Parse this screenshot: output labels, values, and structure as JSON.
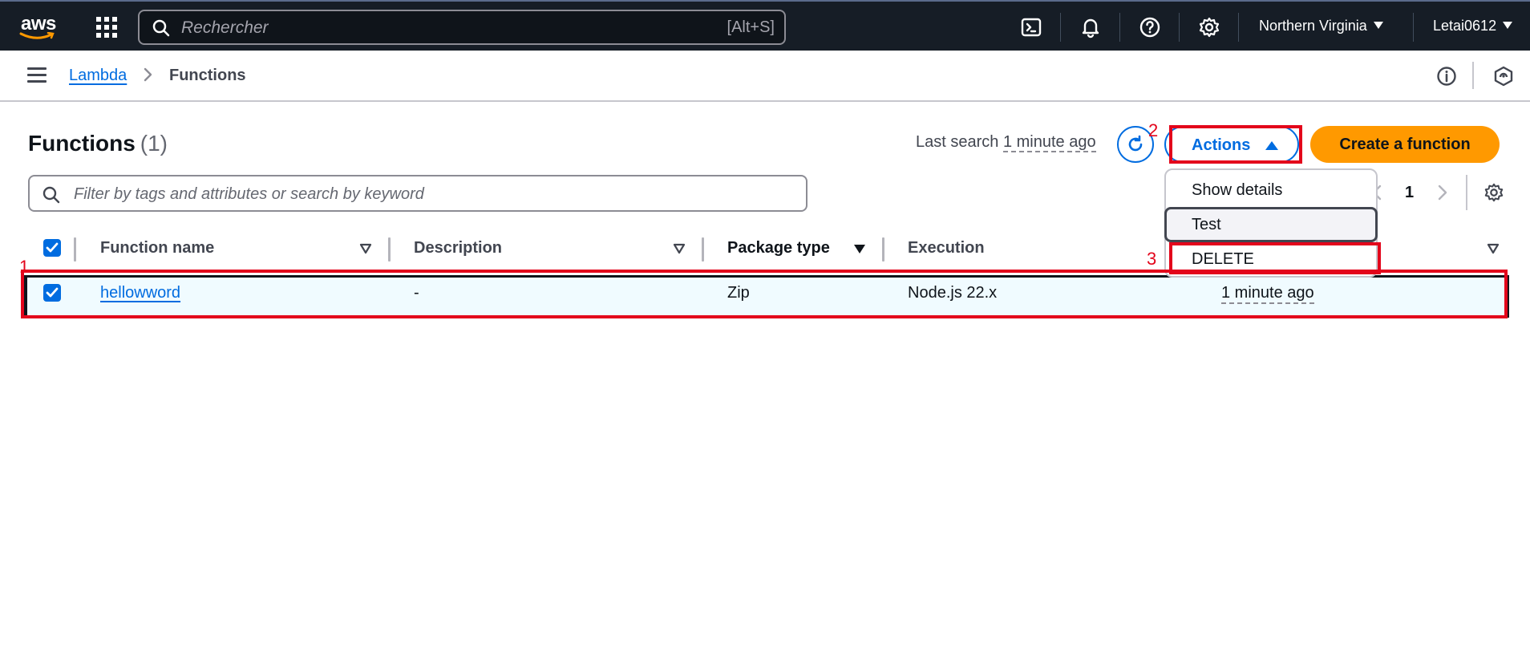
{
  "topbar": {
    "logo_text": "aws",
    "search_placeholder": "Rechercher",
    "search_shortcut": "[Alt+S]",
    "region": "Northern Virginia",
    "user": "Letai0612",
    "icons": [
      "apps-grid-icon",
      "search-icon",
      "cloudshell-icon",
      "bell-icon",
      "help-icon",
      "settings-icon"
    ]
  },
  "breadcrumb": {
    "parent": "Lambda",
    "current": "Functions"
  },
  "header": {
    "title": "Functions",
    "count": "(1)",
    "last_search_label": "Last search",
    "last_search_value": "1 minute ago",
    "actions_label": "Actions",
    "create_label": "Create a function"
  },
  "filter": {
    "placeholder": "Filter by tags and attributes or search by keyword"
  },
  "pagination": {
    "current_page": "1"
  },
  "table": {
    "columns": [
      "Function name",
      "Description",
      "Package type",
      "Execution"
    ],
    "rows": [
      {
        "selected": true,
        "name": "hellowword",
        "description": "-",
        "package_type": "Zip",
        "runtime": "Node.js 22.x",
        "last_modified": "1 minute ago"
      }
    ]
  },
  "actions_menu": {
    "items": [
      "Show details",
      "Test",
      "DELETE"
    ],
    "hovered": "Test"
  },
  "annotations": [
    "1",
    "2",
    "3"
  ],
  "colors": {
    "nav_bg": "#161d26",
    "link_blue": "#006ce0",
    "primary_orange": "#ff9900",
    "annotation_red": "#e3051b",
    "selected_row_bg": "#f0fbff"
  }
}
